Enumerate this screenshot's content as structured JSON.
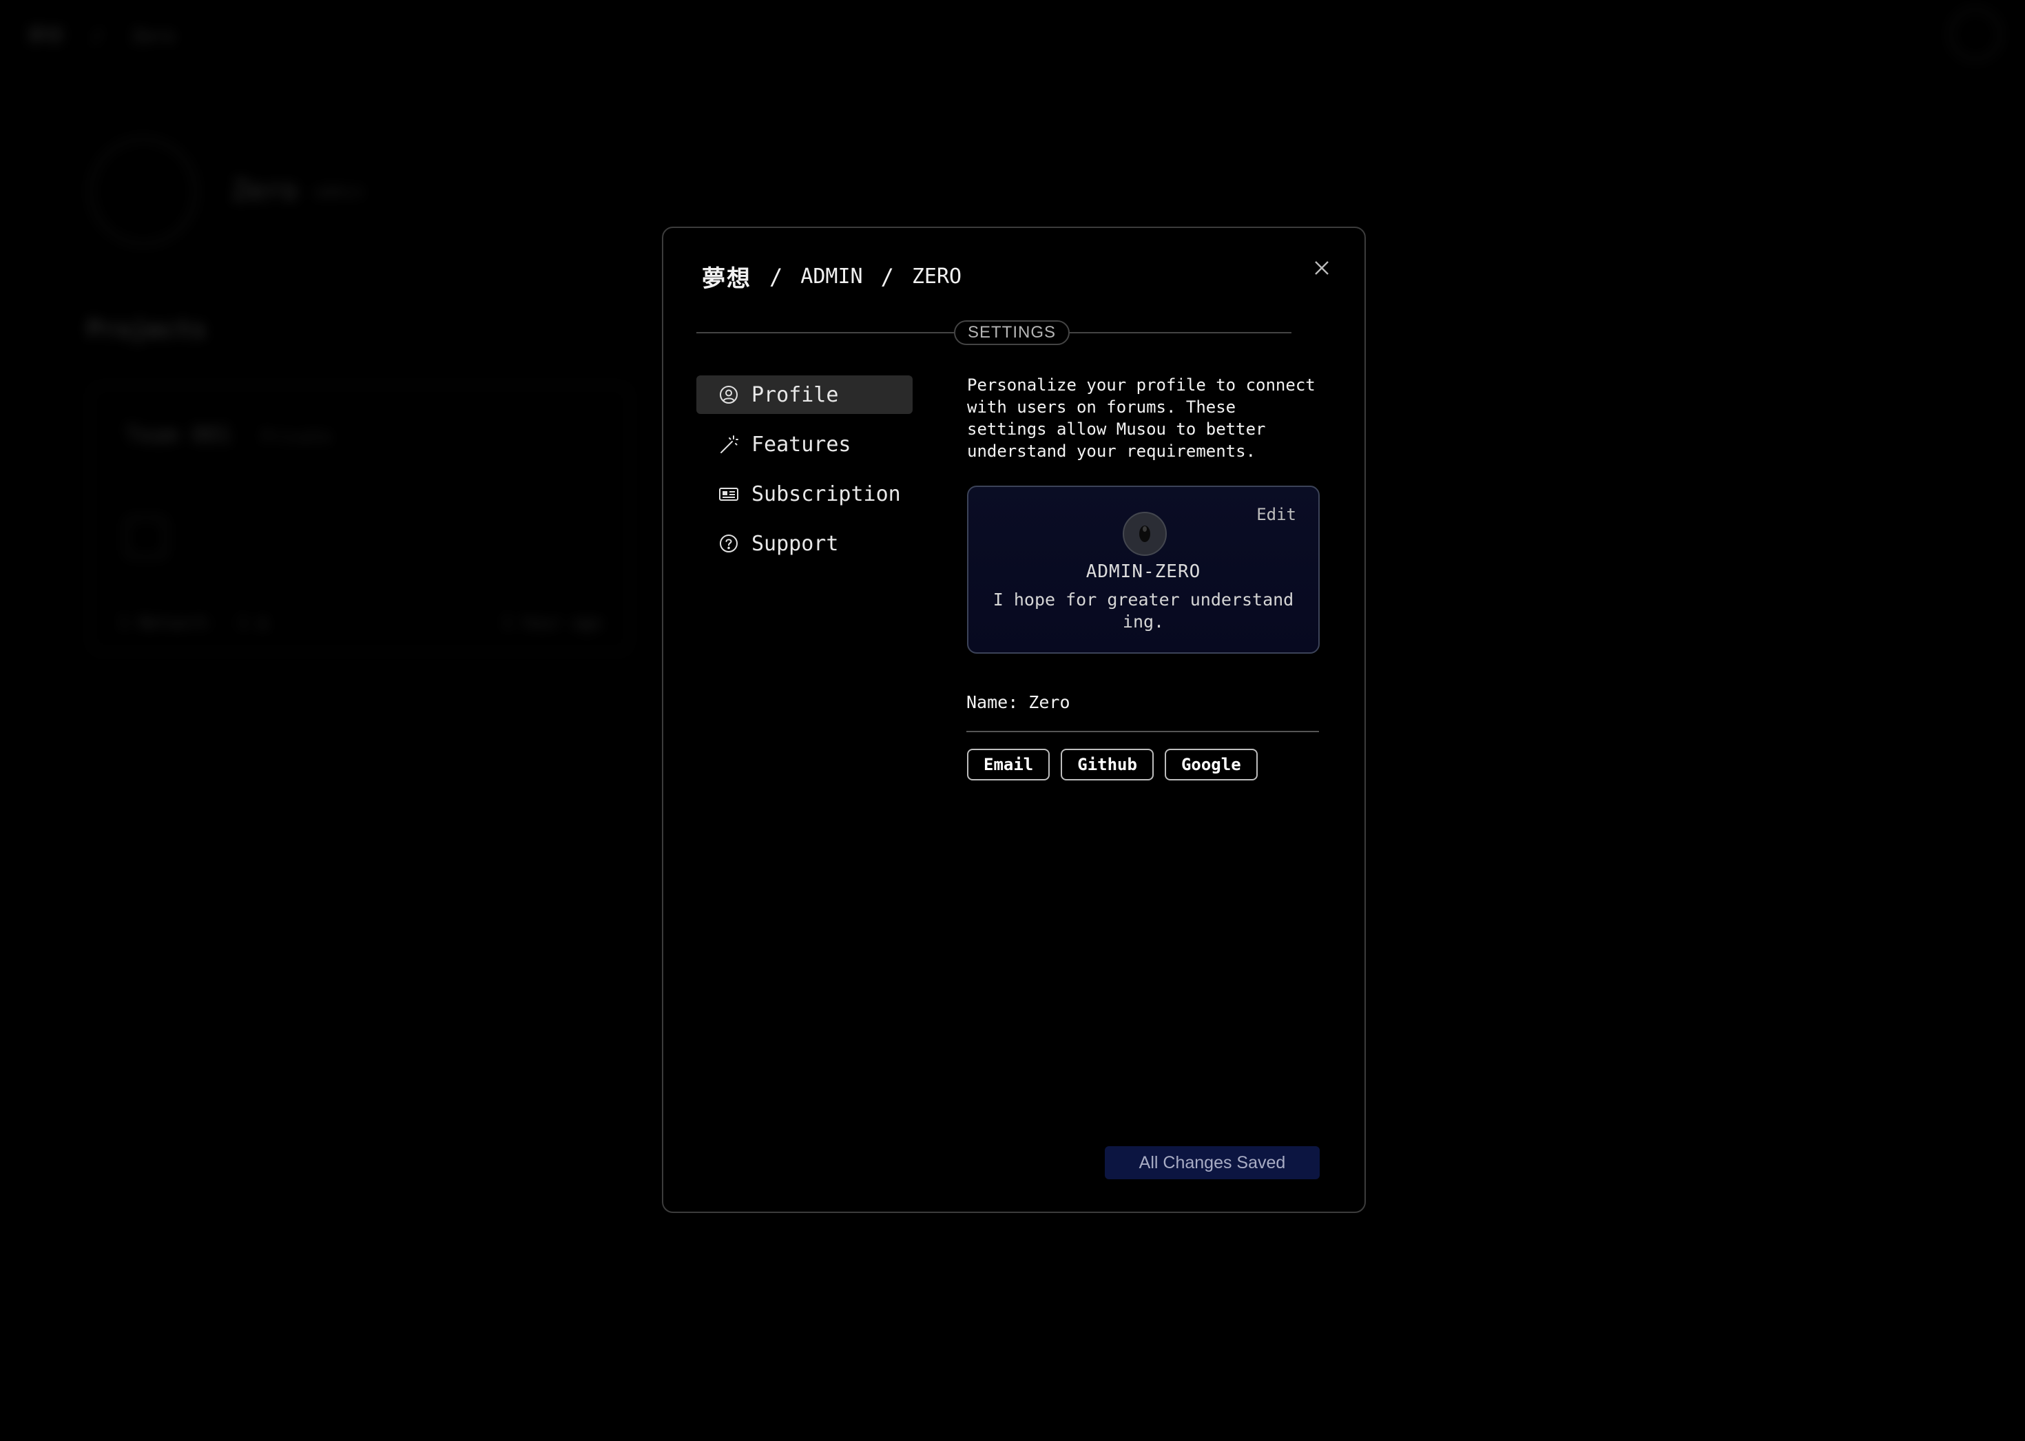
{
  "background": {
    "breadcrumb": [
      "夢想",
      "/",
      "Zero"
    ],
    "user_name": "Zero",
    "user_badge": "admin",
    "projects_heading": "Projects",
    "project_card": {
      "title": "Team 001",
      "badge": "Private",
      "footer_left": "1 Network · 1 ∆",
      "footer_right": "1 hour ago"
    }
  },
  "modal": {
    "breadcrumb": {
      "brand": "夢想",
      "separator": "/",
      "segment1": "ADMIN",
      "segment2": "ZERO"
    },
    "section_label": "SETTINGS",
    "nav": [
      {
        "label": "Profile",
        "icon": "user-circle-icon",
        "active": true
      },
      {
        "label": "Features",
        "icon": "magic-wand-icon",
        "active": false
      },
      {
        "label": "Subscription",
        "icon": "card-icon",
        "active": false
      },
      {
        "label": "Support",
        "icon": "question-circle-icon",
        "active": false
      }
    ],
    "profile": {
      "intro": "Personalize your profile to connect with users on forums. These settings allow Musou to better understand your requirements.",
      "card": {
        "edit_label": "Edit",
        "handle": "ADMIN-ZERO",
        "bio": "I hope for greater understanding."
      },
      "name_label": "Name: Zero",
      "auth_buttons": [
        "Email",
        "Github",
        "Google"
      ]
    },
    "save_status": "All Changes Saved"
  },
  "colors": {
    "background": "#000000",
    "modal_border": "#3c3c3c",
    "active_nav": "#2a2a2a",
    "card_bg": "#0a0d24",
    "save_bg": "#0c1541",
    "save_text": "#a8acc4"
  }
}
